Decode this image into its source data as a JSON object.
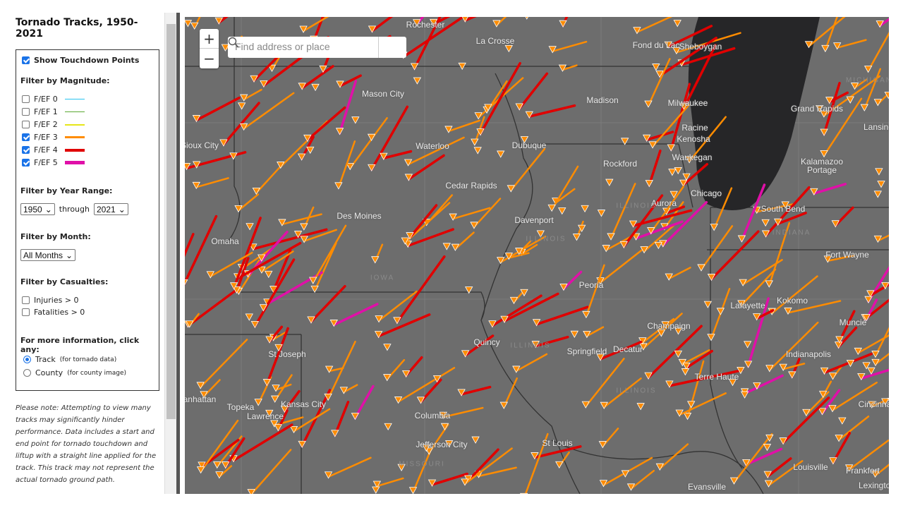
{
  "title": "Tornado Tracks, 1950-2021",
  "touchdown": {
    "label": "Show Touchdown Points",
    "checked": true
  },
  "magnitude": {
    "heading": "Filter by Magnitude:",
    "items": [
      {
        "label": "F/EF 0",
        "color": "#29c4f0",
        "checked": false
      },
      {
        "label": "F/EF 1",
        "color": "#5aa832",
        "checked": false
      },
      {
        "label": "F/EF 2",
        "color": "#e6e619",
        "checked": false
      },
      {
        "label": "F/EF 3",
        "color": "#ff8c00",
        "checked": true
      },
      {
        "label": "F/EF 4",
        "color": "#e00000",
        "checked": true
      },
      {
        "label": "F/EF 5",
        "color": "#e010a8",
        "checked": true
      }
    ]
  },
  "year": {
    "heading": "Filter by Year Range:",
    "from": "1950",
    "through_label": "through",
    "to": "2021"
  },
  "month": {
    "heading": "Filter by Month:",
    "value": "All Months"
  },
  "casualties": {
    "heading": "Filter by Casualties:",
    "items": [
      {
        "label": "Injuries > 0",
        "checked": false
      },
      {
        "label": "Fatalities > 0",
        "checked": false
      }
    ]
  },
  "info": {
    "heading": "For more information, click any:",
    "options": [
      {
        "label": "Track",
        "hint": "(for tornado data)",
        "selected": true
      },
      {
        "label": "County",
        "hint": "(for county image)",
        "selected": false
      }
    ]
  },
  "note": "Please note: Attempting to view many tracks may significantly hinder performance. Data includes a start and end point for tornado touchdown and liftup with a straight line applied for the track. This track may not represent the actual tornado ground path.",
  "map": {
    "search_placeholder": "Find address or place",
    "zoom_in": "+",
    "zoom_out": "−",
    "cities": [
      "Rochester",
      "La Crosse",
      "Fond du Lac",
      "Sheboygan",
      "Mason City",
      "Madison",
      "Milwaukee",
      "Grand Rapids",
      "Lansing",
      "Racine",
      "Kenosha",
      "Sioux City",
      "Waterloo",
      "Dubuque",
      "Waukegan",
      "Rockford",
      "Kalamazoo",
      "Portage",
      "Cedar Rapids",
      "Chicago",
      "Aurora",
      "South Bend",
      "Des Moines",
      "Davenport",
      "Omaha",
      "Fort Wayne",
      "Peoria",
      "Lafayette",
      "Kokomo",
      "Champaign",
      "Muncie",
      "Quincy",
      "Springfield",
      "Decatur",
      "Indianapolis",
      "St Joseph",
      "Terre Haute",
      "Topeka",
      "Kansas City",
      "Lawrence",
      "Columbia",
      "Cincinnati",
      "Jefferson City",
      "St Louis",
      "Louisville",
      "Frankfort",
      "Evansville",
      "Lexington",
      "Manhattan"
    ],
    "states": [
      "ILLINOIS",
      "ILLINOIS",
      "ILLINOIS",
      "ILLINOIS",
      "INDIANA",
      "IOWA",
      "MISSOURI",
      "MICHIGAN"
    ],
    "background": "#6d6d6d",
    "lake_color": "#262628"
  }
}
